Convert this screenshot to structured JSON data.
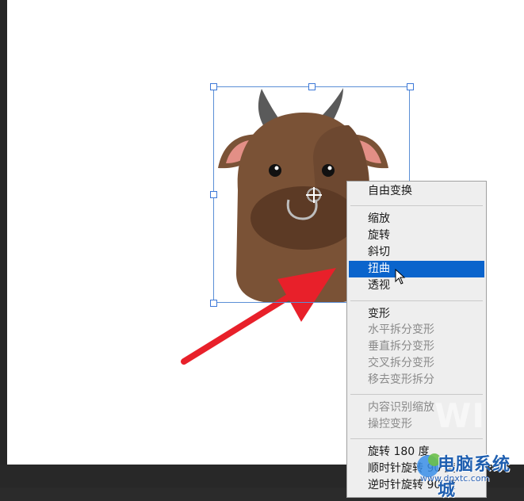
{
  "context_menu": {
    "items": [
      {
        "label": "自由变换",
        "state": "enabled"
      },
      {
        "label": "缩放",
        "state": "enabled"
      },
      {
        "label": "旋转",
        "state": "enabled"
      },
      {
        "label": "斜切",
        "state": "enabled"
      },
      {
        "label": "扭曲",
        "state": "selected"
      },
      {
        "label": "透视",
        "state": "enabled"
      },
      {
        "label": "变形",
        "state": "enabled"
      },
      {
        "label": "水平拆分变形",
        "state": "disabled"
      },
      {
        "label": "垂直拆分变形",
        "state": "disabled"
      },
      {
        "label": "交叉拆分变形",
        "state": "disabled"
      },
      {
        "label": "移去变形拆分",
        "state": "disabled"
      },
      {
        "label": "内容识别缩放",
        "state": "disabled"
      },
      {
        "label": "操控变形",
        "state": "disabled"
      },
      {
        "label": "旋转 180 度",
        "state": "enabled"
      },
      {
        "label": "顺时针旋转 90 度",
        "state": "enabled"
      },
      {
        "label": "逆时针旋转 90 度",
        "state": "enabled"
      }
    ]
  },
  "watermark": {
    "text": "WID"
  },
  "site": {
    "name": "电脑系统城",
    "url": "www.dnxtc.com"
  },
  "colors": {
    "canvas": "#ffffff",
    "workspace": "#2b2b2b",
    "selection_highlight": "#0a64cc",
    "arrow": "#e8202a",
    "bull_body": "#7a5236",
    "bull_muzzle": "#5c3a25",
    "bull_horn": "#5a5a5a",
    "bull_ear_inner": "#e38f86"
  },
  "icons": [
    "pivot-crosshair-icon",
    "mouse-pointer-icon",
    "red-arrow-annotation"
  ]
}
